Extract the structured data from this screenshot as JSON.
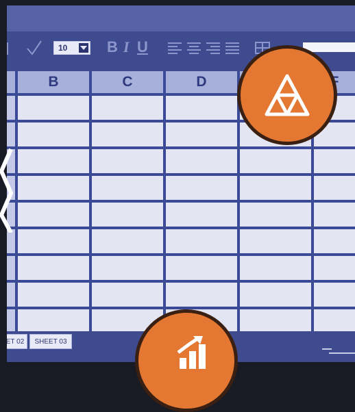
{
  "toolbar": {
    "font_size": "10",
    "bold": "B",
    "italic": "I",
    "underline": "U"
  },
  "columns": [
    "B",
    "C",
    "D",
    "",
    "F"
  ],
  "sheets": [
    "ET 02",
    "SHEET 03"
  ],
  "icons": {
    "check": "check-icon",
    "dropdown": "chevron-down-icon",
    "align_left": "align-left-icon",
    "align_center": "align-center-icon",
    "align_right": "align-right-icon",
    "justify": "justify-icon",
    "borders": "borders-icon",
    "triangle": "triangle-layers-icon",
    "growth": "growth-chart-icon",
    "arrow": "chevron-left-icon"
  },
  "colors": {
    "accent": "#e47833",
    "grid_line": "#3b4a97",
    "cell": "#e3e5f3",
    "header": "#a7b0da",
    "title_bar": "#5562a4"
  }
}
